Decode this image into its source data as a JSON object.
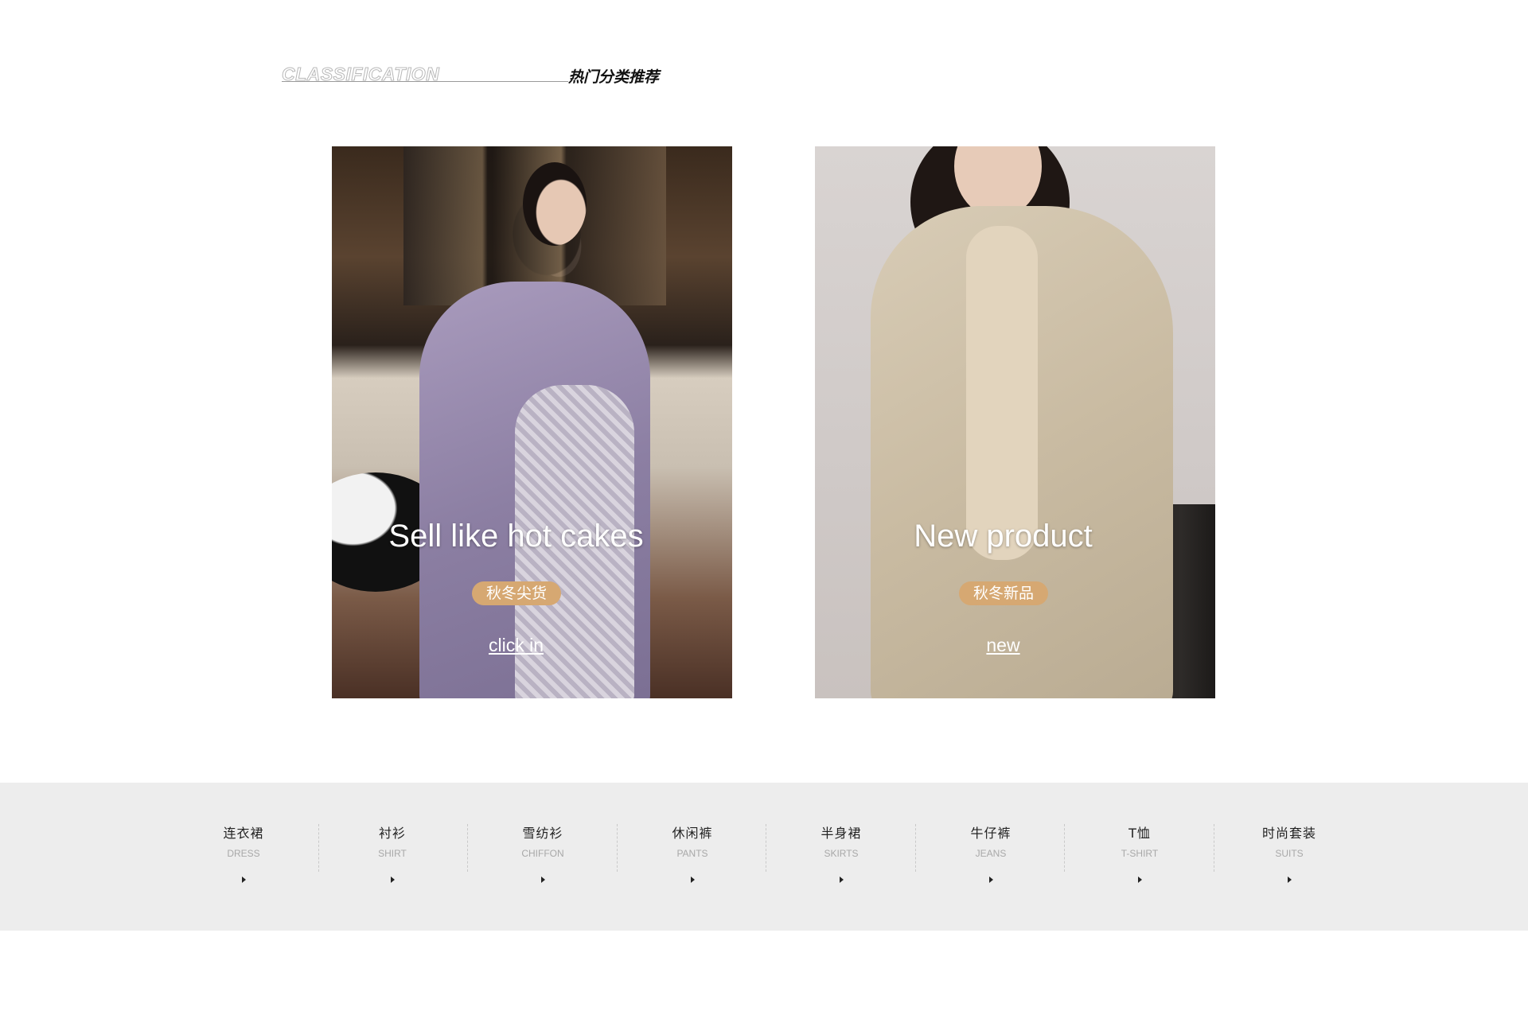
{
  "heading": {
    "en": "CLASSIFICATION",
    "cn": "热门分类推荐"
  },
  "cards": [
    {
      "title": "Sell like hot cakes",
      "badge": "秋冬尖货",
      "link": "click in"
    },
    {
      "title": "New product",
      "badge": "秋冬新品",
      "link": "new"
    }
  ],
  "categories": [
    {
      "cn": "连衣裙",
      "en": "DRESS"
    },
    {
      "cn": "衬衫",
      "en": "SHIRT"
    },
    {
      "cn": "雪纺衫",
      "en": "CHIFFON"
    },
    {
      "cn": "休闲裤",
      "en": "PANTS"
    },
    {
      "cn": "半身裙",
      "en": "SKIRTS"
    },
    {
      "cn": "牛仔裤",
      "en": "JEANS"
    },
    {
      "cn": "T恤",
      "en": "T-SHIRT"
    },
    {
      "cn": "时尚套装",
      "en": "SUITS"
    }
  ],
  "colors": {
    "badge": "#d6a872",
    "category_bar": "#ededed"
  }
}
